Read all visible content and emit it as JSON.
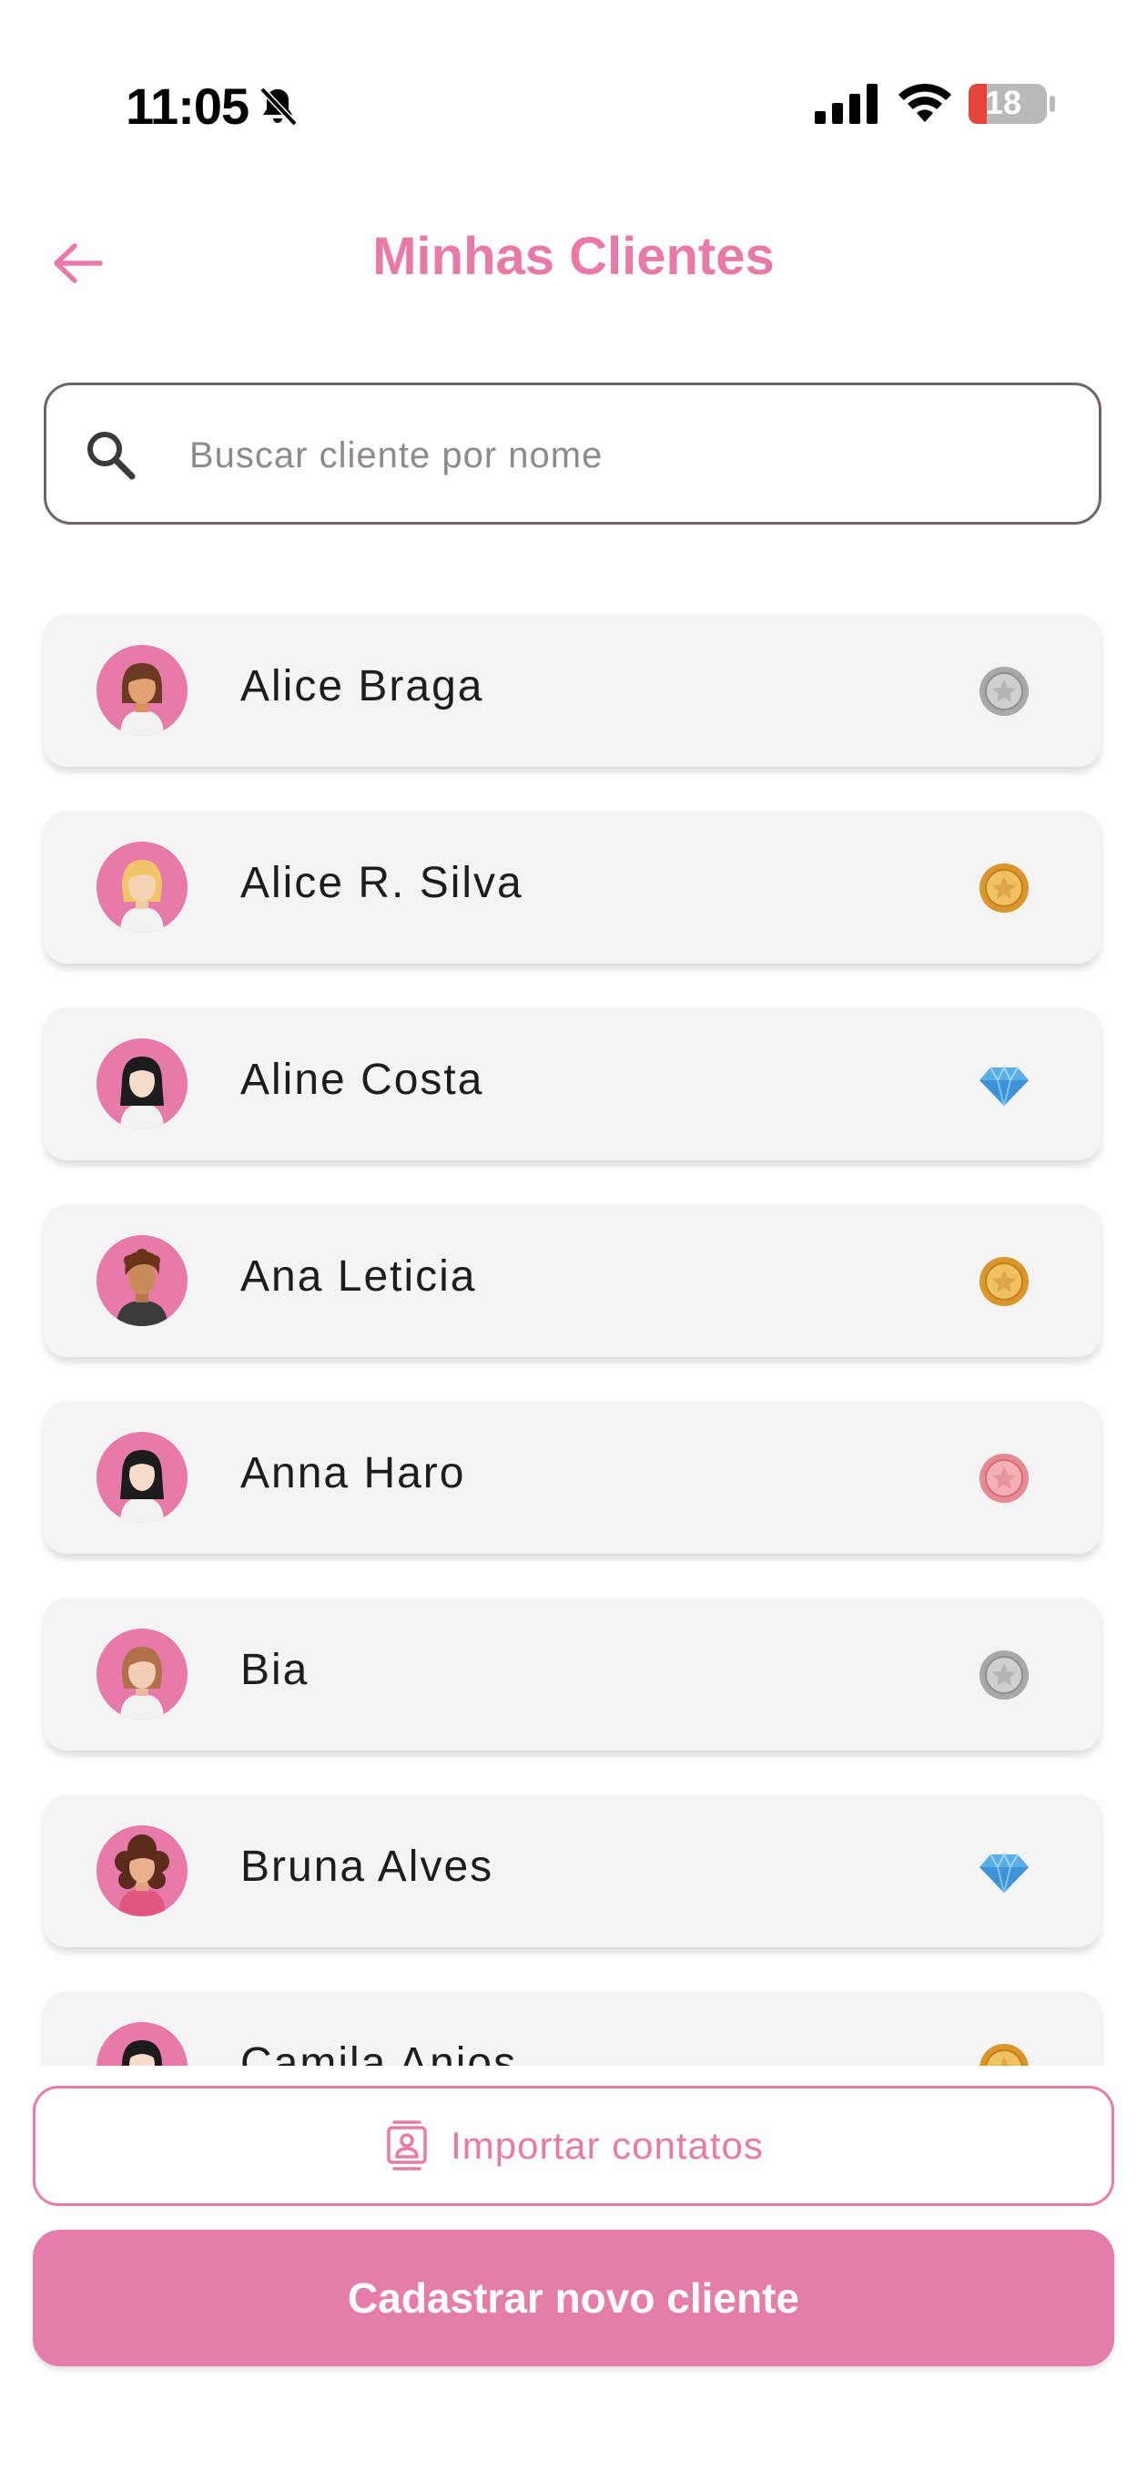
{
  "status_bar": {
    "time": "11:05",
    "battery": "18"
  },
  "header": {
    "title": "Minhas Clientes"
  },
  "search": {
    "placeholder": "Buscar cliente por nome",
    "value": ""
  },
  "clients": [
    {
      "name": "Alice Braga",
      "tier_icon": "silver-medal-icon",
      "avatar": "woman-brown-hair"
    },
    {
      "name": "Alice R. Silva",
      "tier_icon": "gold-medal-icon",
      "avatar": "woman-blonde-hair"
    },
    {
      "name": "Aline Costa",
      "tier_icon": "diamond-icon",
      "avatar": "woman-black-hair"
    },
    {
      "name": "Ana Leticia",
      "tier_icon": "gold-medal-icon",
      "avatar": "person-curly-brown-hair"
    },
    {
      "name": "Anna Haro",
      "tier_icon": "rose-medal-icon",
      "avatar": "woman-black-hair"
    },
    {
      "name": "Bia",
      "tier_icon": "silver-medal-icon",
      "avatar": "woman-light-brown-hair"
    },
    {
      "name": "Bruna Alves",
      "tier_icon": "diamond-icon",
      "avatar": "woman-curly-hair"
    },
    {
      "name": "Camila Anjos",
      "tier_icon": "gold-medal-icon",
      "avatar": "woman-black-hair"
    }
  ],
  "actions": {
    "import_label": "Importar contatos",
    "register_label": "Cadastrar novo cliente"
  },
  "colors": {
    "accent": "#e87aa9",
    "card_bg": "#f4f4f4",
    "diamond": "#5aaee8",
    "gold": "#d9a23b",
    "silver": "#9a9a9a"
  }
}
